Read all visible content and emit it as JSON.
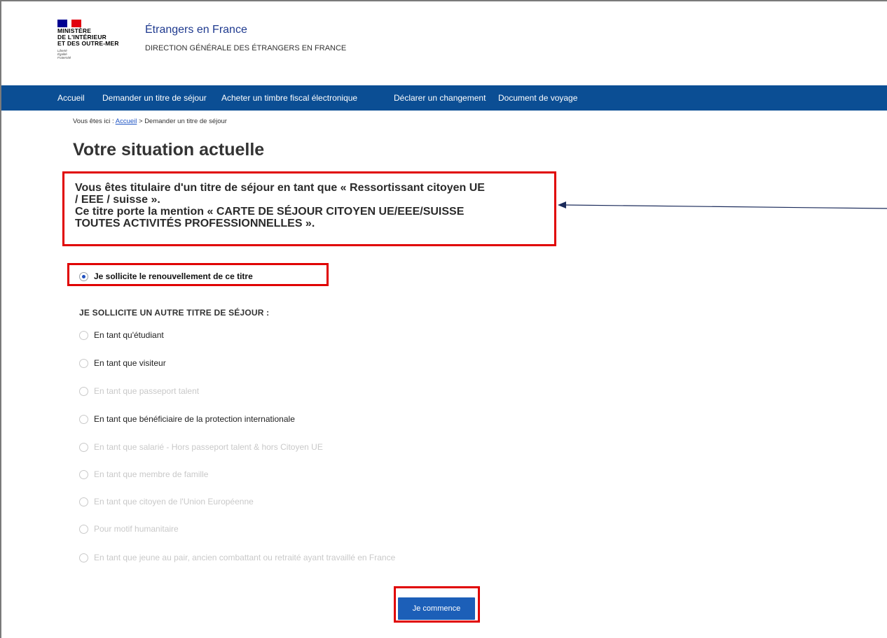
{
  "header": {
    "ministry_lines": [
      "MINISTÈRE",
      "DE L'INTÉRIEUR",
      "ET DES OUTRE-MER"
    ],
    "motto_lines": [
      "Liberté",
      "Égalité",
      "Fraternité"
    ],
    "site_title": "Étrangers en France",
    "site_subtitle": "DIRECTION GÉNÉRALE DES ÉTRANGERS EN FRANCE"
  },
  "nav": {
    "items": [
      "Accueil",
      "Demander un titre de séjour",
      "Acheter un timbre fiscal électronique",
      "Déclarer un changement",
      "Document de voyage"
    ]
  },
  "breadcrumb": {
    "prefix": "Vous êtes ici : ",
    "home": "Accueil",
    "separator": " > ",
    "current": "Demander un titre de séjour"
  },
  "page_title": "Votre situation actuelle",
  "info": {
    "line1": "Vous êtes titulaire d'un titre de séjour en tant que « Ressortissant citoyen UE",
    "line2": "/ EEE / suisse ».",
    "line3": "Ce titre porte la mention « CARTE DE SÉJOUR CITOYEN UE/EEE/SUISSE",
    "line4": "TOUTES ACTIVITÉS PROFESSIONNELLES »."
  },
  "renewal_option": {
    "label": "Je sollicite le renouvellement de ce titre",
    "checked": true
  },
  "other_heading": "JE SOLLICITE UN AUTRE TITRE DE SÉJOUR :",
  "other_options": [
    {
      "label": "En tant qu'étudiant",
      "enabled": true
    },
    {
      "label": "En tant que visiteur",
      "enabled": true
    },
    {
      "label": "En tant que passeport talent",
      "enabled": false
    },
    {
      "label": "En tant que bénéficiaire de la protection internationale",
      "enabled": true
    },
    {
      "label": "En tant que salarié - Hors passeport talent & hors Citoyen UE",
      "enabled": false
    },
    {
      "label": "En tant que membre de famille",
      "enabled": false
    },
    {
      "label": "En tant que citoyen de l'Union Européenne",
      "enabled": false
    },
    {
      "label": "Pour motif humanitaire",
      "enabled": false
    },
    {
      "label": "En tant que jeune au pair, ancien combattant ou retraité ayant travaillé en France",
      "enabled": false
    }
  ],
  "start_button": "Je commence",
  "colors": {
    "nav_bg": "#0b4e94",
    "highlight": "#e00000",
    "button_bg": "#1c5fb8",
    "link": "#1f55c4"
  }
}
